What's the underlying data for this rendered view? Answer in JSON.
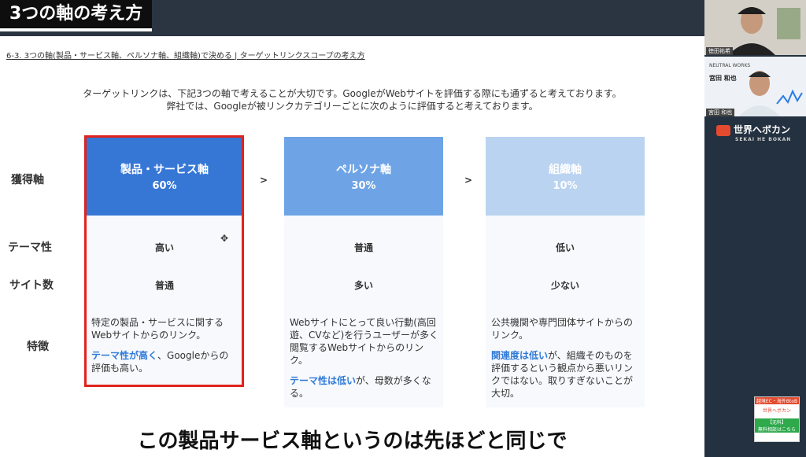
{
  "header": {
    "title": "3つの軸の考え方"
  },
  "slide": {
    "breadcrumb": "6-3. 3つの軸(製品・サービス軸、ペルソナ軸、組織軸)で決める | ターゲットリンクスコープの考え方",
    "intro_line1": "ターゲットリンクは、下記3つの軸で考えることが大切です。GoogleがWebサイトを評価する際にも通ずると考えております。",
    "intro_line2": "弊社では、Googleが被リンクカテゴリーごとに次のように評価すると考えております。",
    "row_labels": {
      "axis": "獲得軸",
      "theme": "テーマ性",
      "sites": "サイト数",
      "features": "特徴"
    },
    "separator": ">",
    "columns": [
      {
        "title": "製品・サービス軸",
        "percent": "60%",
        "color": "#3677d6",
        "theme": "高い",
        "sites": "普通",
        "desc1": "特定の製品・サービスに関するWebサイトからのリンク。",
        "desc2_hl": "テーマ性が高く",
        "desc2_rest": "、Googleからの評価も高い。"
      },
      {
        "title": "ペルソナ軸",
        "percent": "30%",
        "color": "#6ea4e6",
        "theme": "普通",
        "sites": "多い",
        "desc1": "Webサイトにとって良い行動(高回遊、CVなど)を行うユーザーが多く閲覧するWebサイトからのリンク。",
        "desc2_hl": "テーマ性は低い",
        "desc2_rest": "が、母数が多くなる。"
      },
      {
        "title": "組織軸",
        "percent": "10%",
        "color": "#b9d3f1",
        "theme": "低い",
        "sites": "少ない",
        "desc1": "公共機関や専門団体サイトからのリンク。",
        "desc2_hl": "関連度は低い",
        "desc2_rest": "が、組織そのものを評価するという観点から悪いリンクではない。取りすぎないことが大切。"
      }
    ]
  },
  "subtitle": "この製品サービス軸というのは先ほどと同じで",
  "sidebar": {
    "cam1_name": "徳田祐希",
    "cam2_company": "NEUTRAL WORKS",
    "cam2_person": "宮田 和也",
    "cam2_name": "宮田 和也",
    "logo_text": "世界へボカン",
    "logo_sub": "SEKAI HE BOKAN",
    "promo_line1": "越境EC・海外BtoB",
    "promo_line2": "世界へボカン",
    "promo_line3": "【无料】",
    "promo_line4": "無料相談はこちら"
  }
}
